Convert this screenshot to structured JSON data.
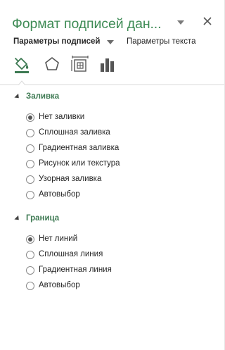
{
  "pane": {
    "title": "Формат подписей дан...",
    "close_symbol": "✕"
  },
  "tabs": {
    "main_label": "Параметры подписей",
    "secondary_label": "Параметры текста"
  },
  "category_icons": [
    "fill-line-icon",
    "effects-icon",
    "size-properties-icon",
    "label-options-icon"
  ],
  "sections": [
    {
      "title": "Заливка",
      "options": [
        {
          "label": "Нет заливки",
          "checked": true
        },
        {
          "label": "Сплошная заливка",
          "checked": false
        },
        {
          "label": "Градиентная заливка",
          "checked": false
        },
        {
          "label": "Рисунок или текстура",
          "checked": false
        },
        {
          "label": "Узорная заливка",
          "checked": false
        },
        {
          "label": "Автовыбор",
          "checked": false
        }
      ]
    },
    {
      "title": "Граница",
      "options": [
        {
          "label": "Нет линий",
          "checked": true
        },
        {
          "label": "Сплошная линия",
          "checked": false
        },
        {
          "label": "Градиентная линия",
          "checked": false
        },
        {
          "label": "Автовыбор",
          "checked": false
        }
      ]
    }
  ],
  "colors": {
    "title_green": "#3e8b55",
    "section_green": "#3e7a53"
  }
}
